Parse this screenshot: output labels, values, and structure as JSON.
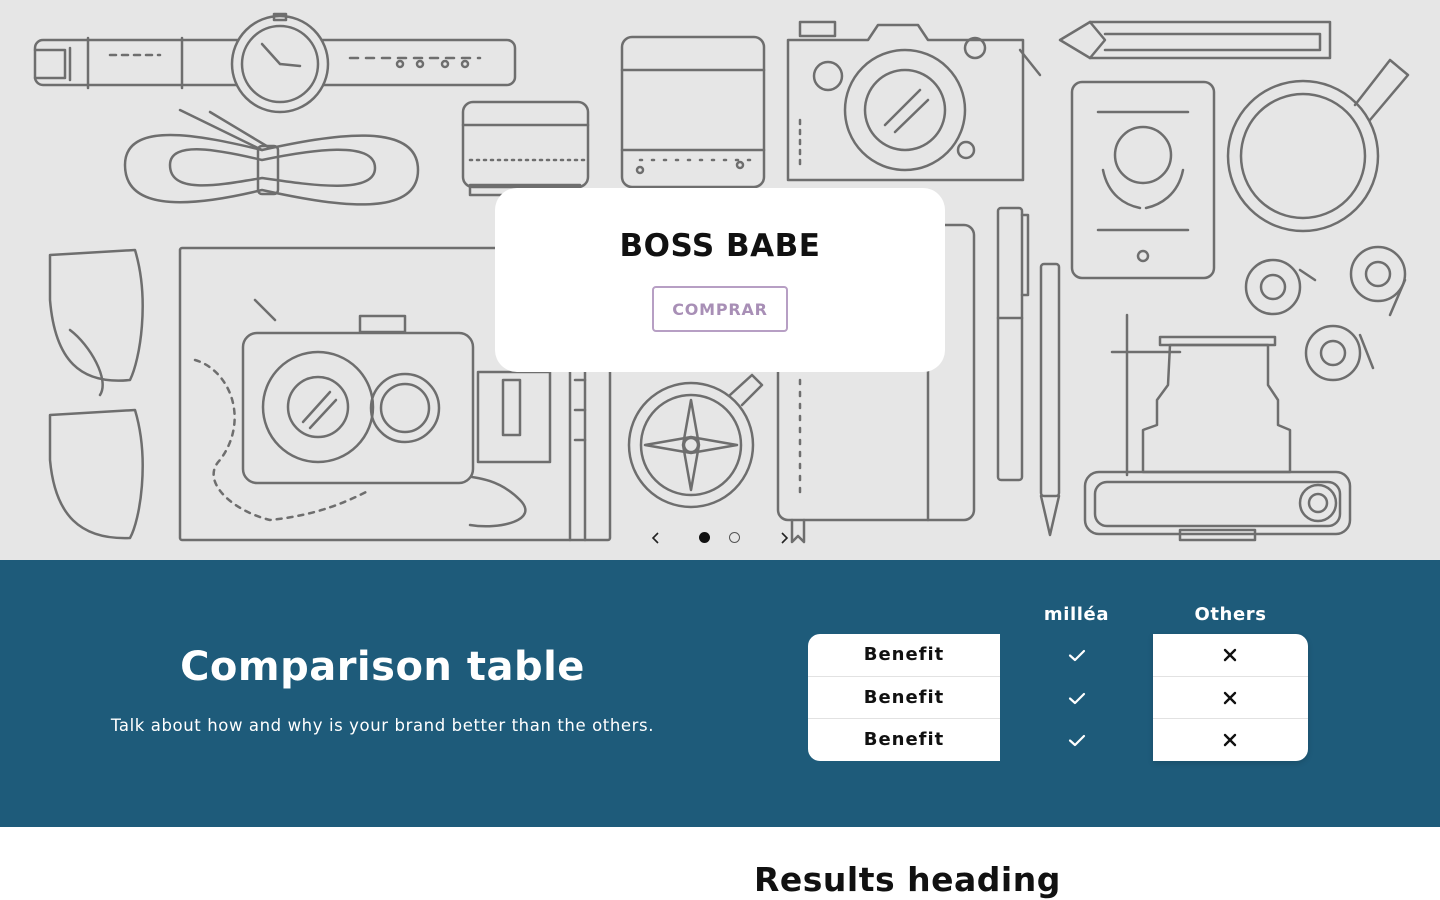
{
  "hero": {
    "title": "BOSS BABE",
    "button_label": "COMPRAR",
    "prev_icon": "chevron-left-icon",
    "next_icon": "chevron-right-icon",
    "slide_count": 2,
    "active_slide": 1
  },
  "comparison": {
    "title": "Comparison table",
    "subtitle": "Talk about how and why is your brand better than the others.",
    "columns": [
      "milléa",
      "Others"
    ],
    "rows": [
      {
        "label": "Benefit",
        "ours": "check-icon",
        "others": "x-icon"
      },
      {
        "label": "Benefit",
        "ours": "check-icon",
        "others": "x-icon"
      },
      {
        "label": "Benefit",
        "ours": "check-icon",
        "others": "x-icon"
      }
    ]
  },
  "results": {
    "title": "Results heading"
  },
  "colors": {
    "hero_bg": "#e6e6e6",
    "band_bg": "#1e5b7a",
    "button_border": "#b79fc4",
    "button_text": "#a88fb6",
    "line_art": "#6e6e6e"
  }
}
